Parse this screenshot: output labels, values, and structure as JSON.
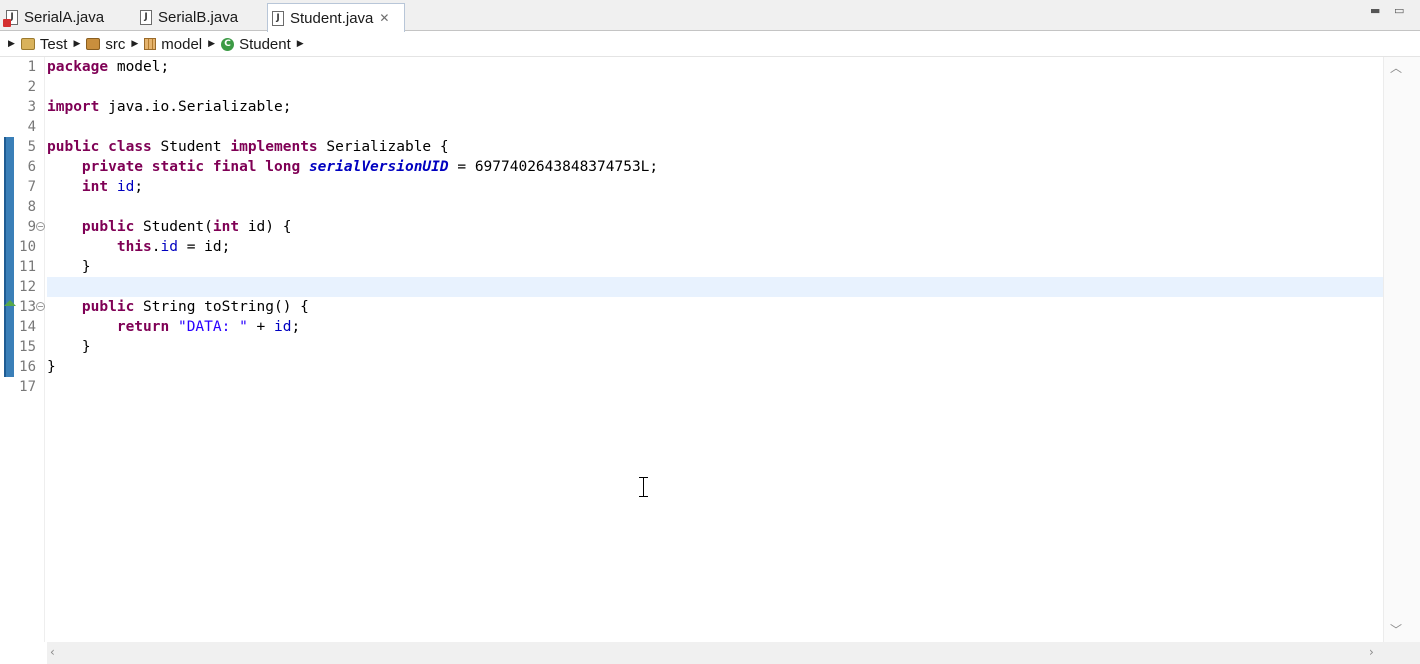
{
  "tabs": [
    {
      "label": "SerialA.java",
      "error": true,
      "active": false
    },
    {
      "label": "SerialB.java",
      "error": false,
      "active": false
    },
    {
      "label": "Student.java",
      "error": false,
      "active": true,
      "close_icon": "close-icon"
    }
  ],
  "window_controls": {
    "minimize": "▭",
    "maximize": "□"
  },
  "breadcrumb": [
    {
      "label": "Test",
      "icon": "project-icon"
    },
    {
      "label": "src",
      "icon": "source-folder-icon"
    },
    {
      "label": "model",
      "icon": "package-icon"
    },
    {
      "label": "Student",
      "icon": "class-icon"
    }
  ],
  "editor": {
    "line_numbers": [
      "1",
      "2",
      "3",
      "4",
      "5",
      "6",
      "7",
      "8",
      "9",
      "10",
      "11",
      "12",
      "13",
      "14",
      "15",
      "16",
      "17"
    ],
    "current_line": 12,
    "fold_markers": [
      9,
      13
    ],
    "lines": [
      [
        {
          "t": "package",
          "c": "kw"
        },
        {
          "t": " model;",
          "c": ""
        }
      ],
      [],
      [
        {
          "t": "import",
          "c": "kw"
        },
        {
          "t": " java.io.Serializable;",
          "c": ""
        }
      ],
      [],
      [
        {
          "t": "public",
          "c": "kw"
        },
        {
          "t": " ",
          "c": ""
        },
        {
          "t": "class",
          "c": "kw"
        },
        {
          "t": " Student ",
          "c": ""
        },
        {
          "t": "implements",
          "c": "kw"
        },
        {
          "t": " Serializable {",
          "c": ""
        }
      ],
      [
        {
          "t": "    ",
          "c": ""
        },
        {
          "t": "private",
          "c": "kw"
        },
        {
          "t": " ",
          "c": ""
        },
        {
          "t": "static",
          "c": "kw"
        },
        {
          "t": " ",
          "c": ""
        },
        {
          "t": "final",
          "c": "kw"
        },
        {
          "t": " ",
          "c": ""
        },
        {
          "t": "long",
          "c": "kw"
        },
        {
          "t": " ",
          "c": ""
        },
        {
          "t": "serialVersionUID",
          "c": "sfld"
        },
        {
          "t": " = 6977402643848374753L;",
          "c": ""
        }
      ],
      [
        {
          "t": "    ",
          "c": ""
        },
        {
          "t": "int",
          "c": "kw"
        },
        {
          "t": " ",
          "c": ""
        },
        {
          "t": "id",
          "c": "fld"
        },
        {
          "t": ";",
          "c": ""
        }
      ],
      [],
      [
        {
          "t": "    ",
          "c": ""
        },
        {
          "t": "public",
          "c": "kw"
        },
        {
          "t": " Student(",
          "c": ""
        },
        {
          "t": "int",
          "c": "kw"
        },
        {
          "t": " id) {",
          "c": ""
        }
      ],
      [
        {
          "t": "        ",
          "c": ""
        },
        {
          "t": "this",
          "c": "kw"
        },
        {
          "t": ".",
          "c": ""
        },
        {
          "t": "id",
          "c": "fld"
        },
        {
          "t": " = id;",
          "c": ""
        }
      ],
      [
        {
          "t": "    }",
          "c": ""
        }
      ],
      [],
      [
        {
          "t": "    ",
          "c": ""
        },
        {
          "t": "public",
          "c": "kw"
        },
        {
          "t": " String toString() {",
          "c": ""
        }
      ],
      [
        {
          "t": "        ",
          "c": ""
        },
        {
          "t": "return",
          "c": "kw"
        },
        {
          "t": " ",
          "c": ""
        },
        {
          "t": "\"DATA: \"",
          "c": "str"
        },
        {
          "t": " + ",
          "c": ""
        },
        {
          "t": "id",
          "c": "fld"
        },
        {
          "t": ";",
          "c": ""
        }
      ],
      [
        {
          "t": "    }",
          "c": ""
        }
      ],
      [
        {
          "t": "}",
          "c": ""
        }
      ],
      []
    ]
  },
  "scroll_icons": {
    "up": "▲",
    "down": "▼",
    "left": "◀",
    "right": "▶"
  }
}
